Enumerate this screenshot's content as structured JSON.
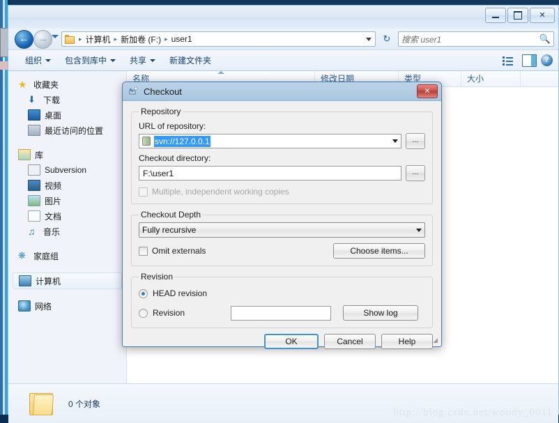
{
  "window": {
    "buttons": {
      "minimize": "—",
      "maximize": "▭",
      "close": "✕"
    }
  },
  "address": {
    "crumbs": [
      "计算机",
      "新加卷 (F:)",
      "user1"
    ],
    "separator": "▸",
    "dropdown_icon": "chevron-down-icon",
    "refresh_icon": "↻"
  },
  "search": {
    "placeholder": "搜索 user1",
    "value": "",
    "icon": "search-icon"
  },
  "commandbar": {
    "items": [
      {
        "label": "组织",
        "has_menu": true
      },
      {
        "label": "包含到库中",
        "has_menu": true
      },
      {
        "label": "共享",
        "has_menu": true
      },
      {
        "label": "新建文件夹",
        "has_menu": false
      }
    ],
    "view_icon": "list-view-icon",
    "view_dropdown": "chevron-down-icon",
    "pane_icon": "preview-pane-icon",
    "help_icon": "help-icon",
    "help_label": "?"
  },
  "sidebar": {
    "groups": [
      {
        "header": {
          "label": "收藏夹",
          "icon": "star-icon"
        },
        "items": [
          {
            "label": "下载",
            "icon": "downloads-icon"
          },
          {
            "label": "桌面",
            "icon": "desktop-icon"
          },
          {
            "label": "最近访问的位置",
            "icon": "recent-places-icon"
          }
        ]
      },
      {
        "header": {
          "label": "库",
          "icon": "library-icon"
        },
        "items": [
          {
            "label": "Subversion",
            "icon": "subversion-icon"
          },
          {
            "label": "视频",
            "icon": "video-icon"
          },
          {
            "label": "图片",
            "icon": "pictures-icon"
          },
          {
            "label": "文档",
            "icon": "documents-icon"
          },
          {
            "label": "音乐",
            "icon": "music-icon"
          }
        ]
      },
      {
        "header": {
          "label": "家庭组",
          "icon": "homegroup-icon"
        },
        "items": []
      },
      {
        "header": {
          "label": "计算机",
          "icon": "computer-icon",
          "selected": true
        },
        "items": []
      },
      {
        "header": {
          "label": "网络",
          "icon": "network-icon"
        },
        "items": []
      }
    ]
  },
  "list": {
    "columns": [
      "名称",
      "修改日期",
      "类型",
      "大小"
    ],
    "sort_column": "名称",
    "rows": []
  },
  "status": {
    "text": "0 个对象",
    "icon": "folder-icon"
  },
  "watermark": "http://blog.csdn.net/woody_0011",
  "dialog": {
    "title": "Checkout",
    "title_icon": "checkout-icon",
    "close_label": "✕",
    "repository": {
      "legend": "Repository",
      "url_label": "URL of repository:",
      "url_value": "svn://127.0.0.1",
      "url_selected": true,
      "url_icon": "repository-icon",
      "browse_label": "...",
      "dir_label": "Checkout directory:",
      "dir_value": "F:\\user1",
      "dir_browse_label": "...",
      "multiple_label": "Multiple, independent working copies",
      "multiple_checked": false,
      "multiple_disabled": true
    },
    "depth": {
      "legend": "Checkout Depth",
      "value": "Fully recursive",
      "omit_label": "Omit externals",
      "omit_checked": false,
      "choose_label": "Choose items..."
    },
    "revision": {
      "legend": "Revision",
      "head_label": "HEAD revision",
      "head_selected": true,
      "rev_label": "Revision",
      "rev_selected": false,
      "rev_value": "",
      "showlog_label": "Show log"
    },
    "footer": {
      "ok": "OK",
      "cancel": "Cancel",
      "help": "Help"
    }
  }
}
